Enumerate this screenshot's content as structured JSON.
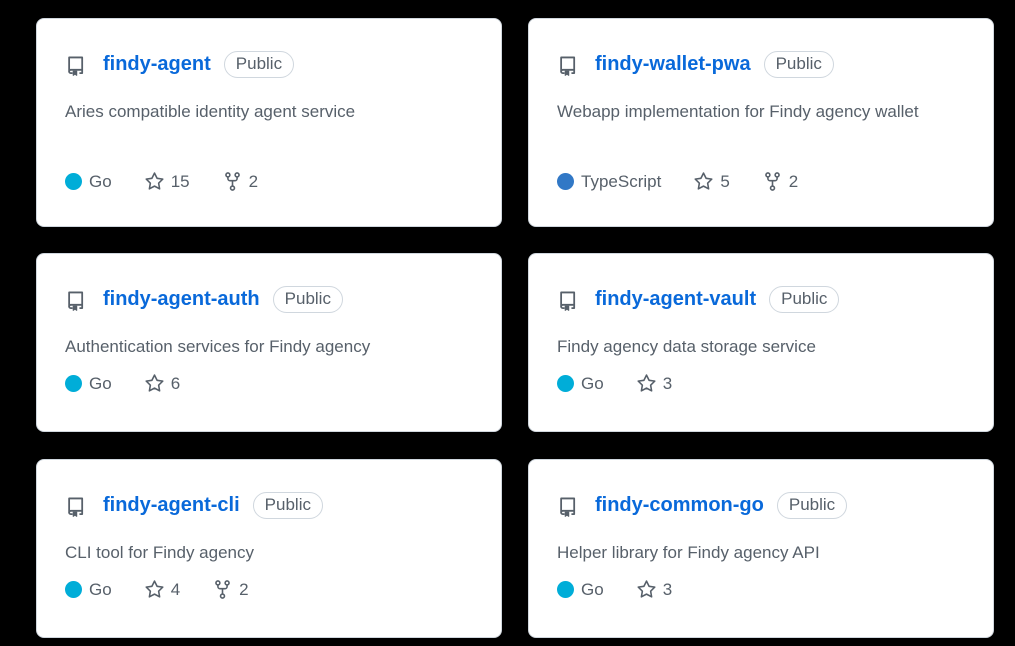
{
  "badge_label": "Public",
  "language_colors": {
    "Go": "#00add8",
    "TypeScript": "#3178c6"
  },
  "repos": [
    {
      "name": "findy-agent",
      "description": "Aries compatible identity agent service",
      "language": "Go",
      "language_color": "#00add8",
      "stars": "15",
      "forks": "2"
    },
    {
      "name": "findy-wallet-pwa",
      "description": "Webapp implementation for Findy agency wallet",
      "language": "TypeScript",
      "language_color": "#3178c6",
      "stars": "5",
      "forks": "2"
    },
    {
      "name": "findy-agent-auth",
      "description": "Authentication services for Findy agency",
      "language": "Go",
      "language_color": "#00add8",
      "stars": "6",
      "forks": null
    },
    {
      "name": "findy-agent-vault",
      "description": "Findy agency data storage service",
      "language": "Go",
      "language_color": "#00add8",
      "stars": "3",
      "forks": null
    },
    {
      "name": "findy-agent-cli",
      "description": "CLI tool for Findy agency",
      "language": "Go",
      "language_color": "#00add8",
      "stars": "4",
      "forks": "2"
    },
    {
      "name": "findy-common-go",
      "description": "Helper library for Findy agency API",
      "language": "Go",
      "language_color": "#00add8",
      "stars": "3",
      "forks": null
    }
  ]
}
